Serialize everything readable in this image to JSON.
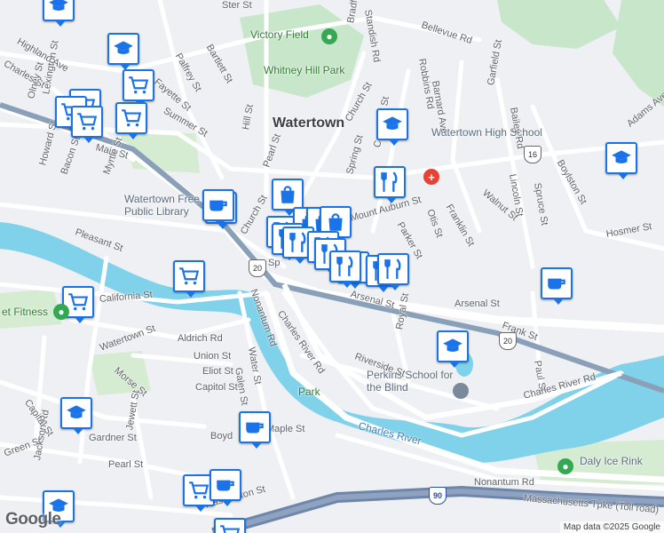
{
  "map": {
    "place_labels": [
      {
        "text": "Watertown",
        "kind": "big"
      },
      {
        "text": "Victory Field",
        "kind": "park"
      },
      {
        "text": "Whitney Hill Park",
        "kind": "park"
      },
      {
        "text": "Watertown High School",
        "kind": "poi"
      },
      {
        "text": "Watertown Free Public Library",
        "kind": "poi"
      },
      {
        "text": "Perkins School for the Blind",
        "kind": "poi"
      },
      {
        "text": "Daly Ice Rink",
        "kind": "poi"
      },
      {
        "text": "Charles River",
        "kind": "water"
      },
      {
        "text": "Park",
        "kind": "park"
      },
      {
        "text": "et Fitness",
        "kind": "park"
      }
    ],
    "street_labels": [
      "Bellevue Rd",
      "Standish Rd",
      "Bradford",
      "Highland Ave",
      "Charles St",
      "Olney St",
      "Lexington St",
      "Palfrey St",
      "Bartlett St",
      "Fayette St",
      "Summer St",
      "Hill St",
      "Church St",
      "Robbins Rd",
      "Barnard Ave",
      "Garfield St",
      "Bailey Rd",
      "Adams Ave",
      "Main St",
      "Howard St",
      "Bacon St",
      "Myrtle St",
      "Pearl St",
      "Spring St",
      "Common St",
      "Mount Auburn St",
      "Parker St",
      "Otis St",
      "Franklin St",
      "Walnut St",
      "Lincoln St",
      "Spruce St",
      "Boylston St",
      "Hosmer St",
      "Pleasant St",
      "Arsenal St",
      "California St",
      "Watertown St",
      "Aldrich Rd",
      "Union St",
      "Eliot St",
      "Capitol St",
      "Morse St",
      "Galen St",
      "Water St",
      "Nonantum Rd",
      "Charles River Rd",
      "Riverside St",
      "Royal St",
      "Frank St",
      "Paul St",
      "Gardner St",
      "Jewett St",
      "Green St",
      "Jackson Rd",
      "Boyd",
      "Maple St",
      "Washington St",
      "Massachusetts Tpke (Toll road)",
      "Nonantum Rd",
      "Charles River Rd",
      "Arsenal St",
      "Pearl St",
      "Capital St",
      "Ster St",
      "Church St",
      "Sp",
      "Mt"
    ],
    "route_shields": [
      "20",
      "20",
      "16",
      "20",
      "90"
    ],
    "pins": [
      "school",
      "shopping-cart",
      "school",
      "shopping-cart",
      "shopping-cart",
      "shopping-cart",
      "shopping-cart",
      "coffee",
      "shopping-bag",
      "restaurant",
      "shopping-bag",
      "restaurant",
      "shopping-bag",
      "restaurant",
      "shopping-bag",
      "restaurant",
      "restaurant",
      "shopping-bag",
      "restaurant",
      "restaurant",
      "restaurant",
      "school",
      "restaurant",
      "school",
      "coffee",
      "shopping-cart",
      "shopping-cart",
      "school",
      "school",
      "school",
      "coffee",
      "shopping-cart",
      "coffee",
      "shopping-cart",
      "coffee"
    ],
    "logo": "Google",
    "attribution": "Map data ©2025 Google"
  }
}
